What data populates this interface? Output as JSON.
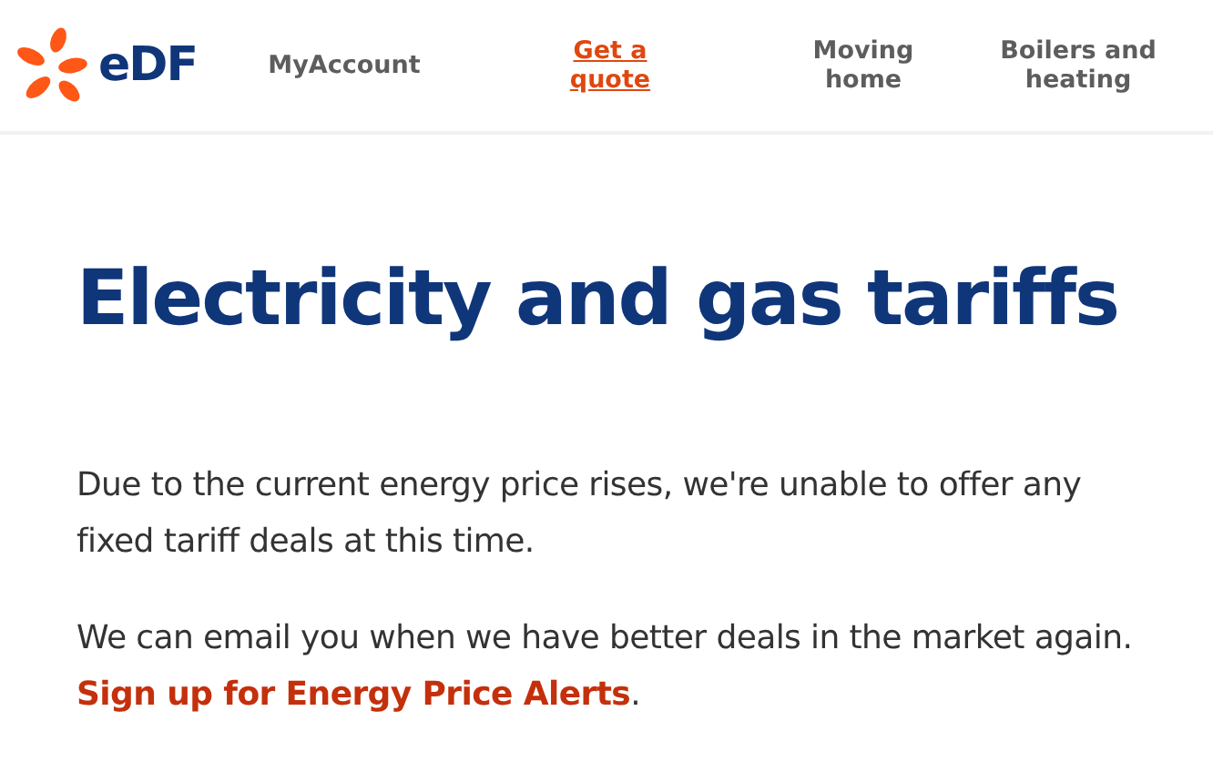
{
  "header": {
    "logo_text": "eDF",
    "nav": [
      {
        "label": "MyAccount",
        "selected": false
      },
      {
        "label": "Get a quote",
        "selected": true
      },
      {
        "label": "Moving home",
        "selected": false
      },
      {
        "label": "Boilers and heating",
        "selected": false
      }
    ]
  },
  "title": "Electricity and gas tariffs",
  "paragraphs": [
    {
      "text": "Due to the current energy price rises, we're unable to offer any fixed tariff deals at this time."
    },
    {
      "text": "We can email you when we have better deals in the market again.",
      "link": "Sign up for Energy Price Alerts",
      "after": "."
    }
  ]
}
